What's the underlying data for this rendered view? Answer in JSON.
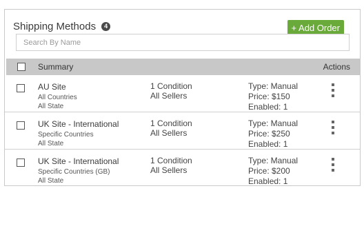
{
  "header": {
    "title": "Shipping Methods",
    "count": "4",
    "add_button": "+ Add Order"
  },
  "search": {
    "placeholder": "Search By Name"
  },
  "table": {
    "columns": {
      "summary": "Summary",
      "actions": "Actions"
    },
    "rows": [
      {
        "name": "AU Site",
        "countries": "All Countries",
        "state": "All State",
        "condition": "1 Condition",
        "sellers": "All Sellers",
        "type": "Type: Manual",
        "price": "Price: $150",
        "enabled": "Enabled: 1"
      },
      {
        "name": "UK Site - International",
        "countries": "Specific Countries",
        "state": "All State",
        "condition": "1 Condition",
        "sellers": "All Sellers",
        "type": "Type: Manual",
        "price": "Price: $250",
        "enabled": "Enabled: 1"
      },
      {
        "name": "UK Site - International",
        "countries": "Specific Countries (GB)",
        "state": "All State",
        "condition": "1 Condition",
        "sellers": "All Sellers",
        "type": "Type: Manual",
        "price": "Price: $200",
        "enabled": "Enabled: 1"
      }
    ]
  },
  "colors": {
    "accent": "#6aaa3a",
    "header_bg": "#c8c8c8",
    "badge": "#4a4a4a"
  }
}
